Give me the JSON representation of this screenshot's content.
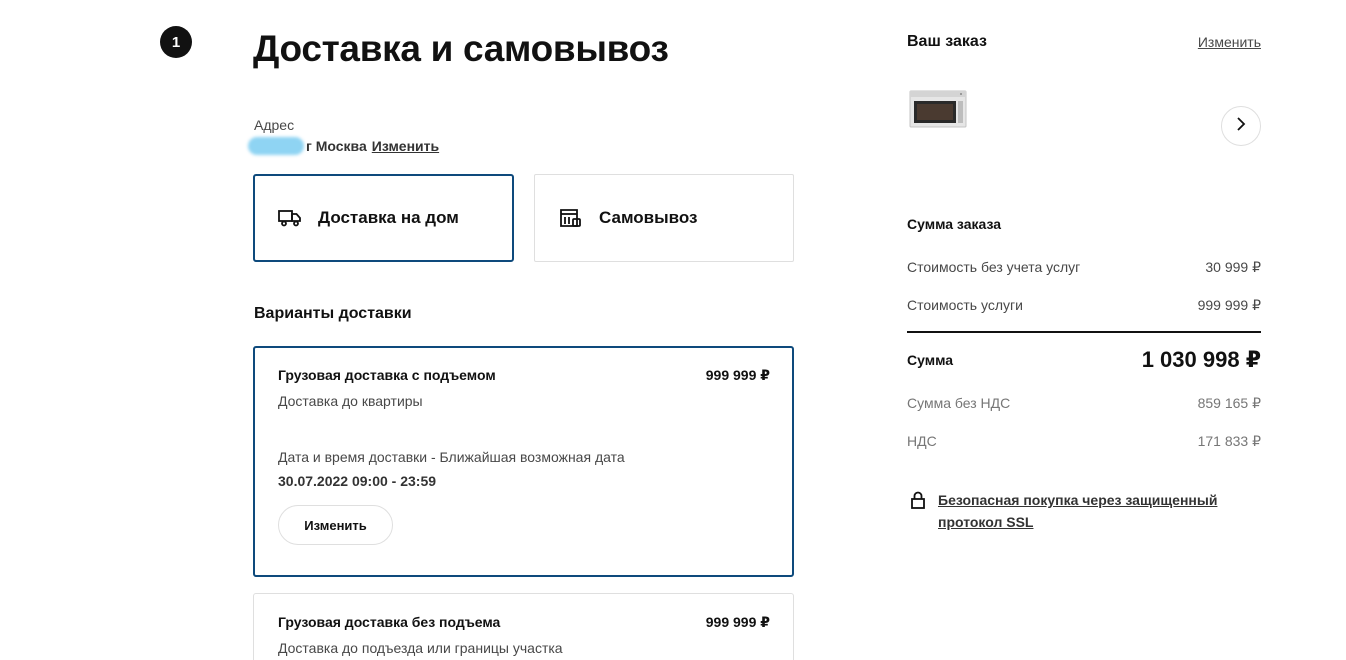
{
  "step": {
    "number": "1"
  },
  "page": {
    "title": "Доставка и самовывоз"
  },
  "address": {
    "label": "Адрес",
    "city": "г Москва",
    "change_label": "Изменить"
  },
  "methods": [
    {
      "label": "Доставка на дом",
      "icon": "truck-icon",
      "selected": true
    },
    {
      "label": "Самовывоз",
      "icon": "store-icon",
      "selected": false
    }
  ],
  "options_heading": "Варианты доставки",
  "options": [
    {
      "title": "Грузовая доставка с подъемом",
      "price": "999 999 ₽",
      "subtitle": "Доставка до квартиры",
      "date_label": "Дата и время доставки - Ближайшая возможная дата",
      "date_value": "30.07.2022 09:00 - 23:59",
      "change_label": "Изменить",
      "selected": true
    },
    {
      "title": "Грузовая доставка без подъема",
      "price": "999 999 ₽",
      "subtitle": "Доставка до подъезда или границы участка",
      "selected": false
    }
  ],
  "order": {
    "title": "Ваш заказ",
    "change_label": "Изменить",
    "product_icon": "microwave-oven-thumbnail",
    "next_icon": "chevron-right-icon"
  },
  "summary": {
    "title": "Сумма заказа",
    "rows": [
      {
        "label": "Стоимость без учета услуг",
        "value": "30 999 ₽"
      },
      {
        "label": "Стоимость услуги",
        "value": "999 999 ₽"
      }
    ],
    "total_label": "Сумма",
    "total_value": "1 030 998 ₽",
    "tax_rows": [
      {
        "label": "Сумма без НДС",
        "value": "859 165 ₽"
      },
      {
        "label": "НДС",
        "value": "171 833 ₽"
      }
    ]
  },
  "ssl": {
    "text": "Безопасная покупка через защищенный протокол SSL",
    "icon": "lock-icon"
  },
  "colors": {
    "accent": "#0e4a7c",
    "text": "#111111",
    "muted": "#484848",
    "border": "#dfdfdf",
    "blur": "#8fd4f3"
  }
}
